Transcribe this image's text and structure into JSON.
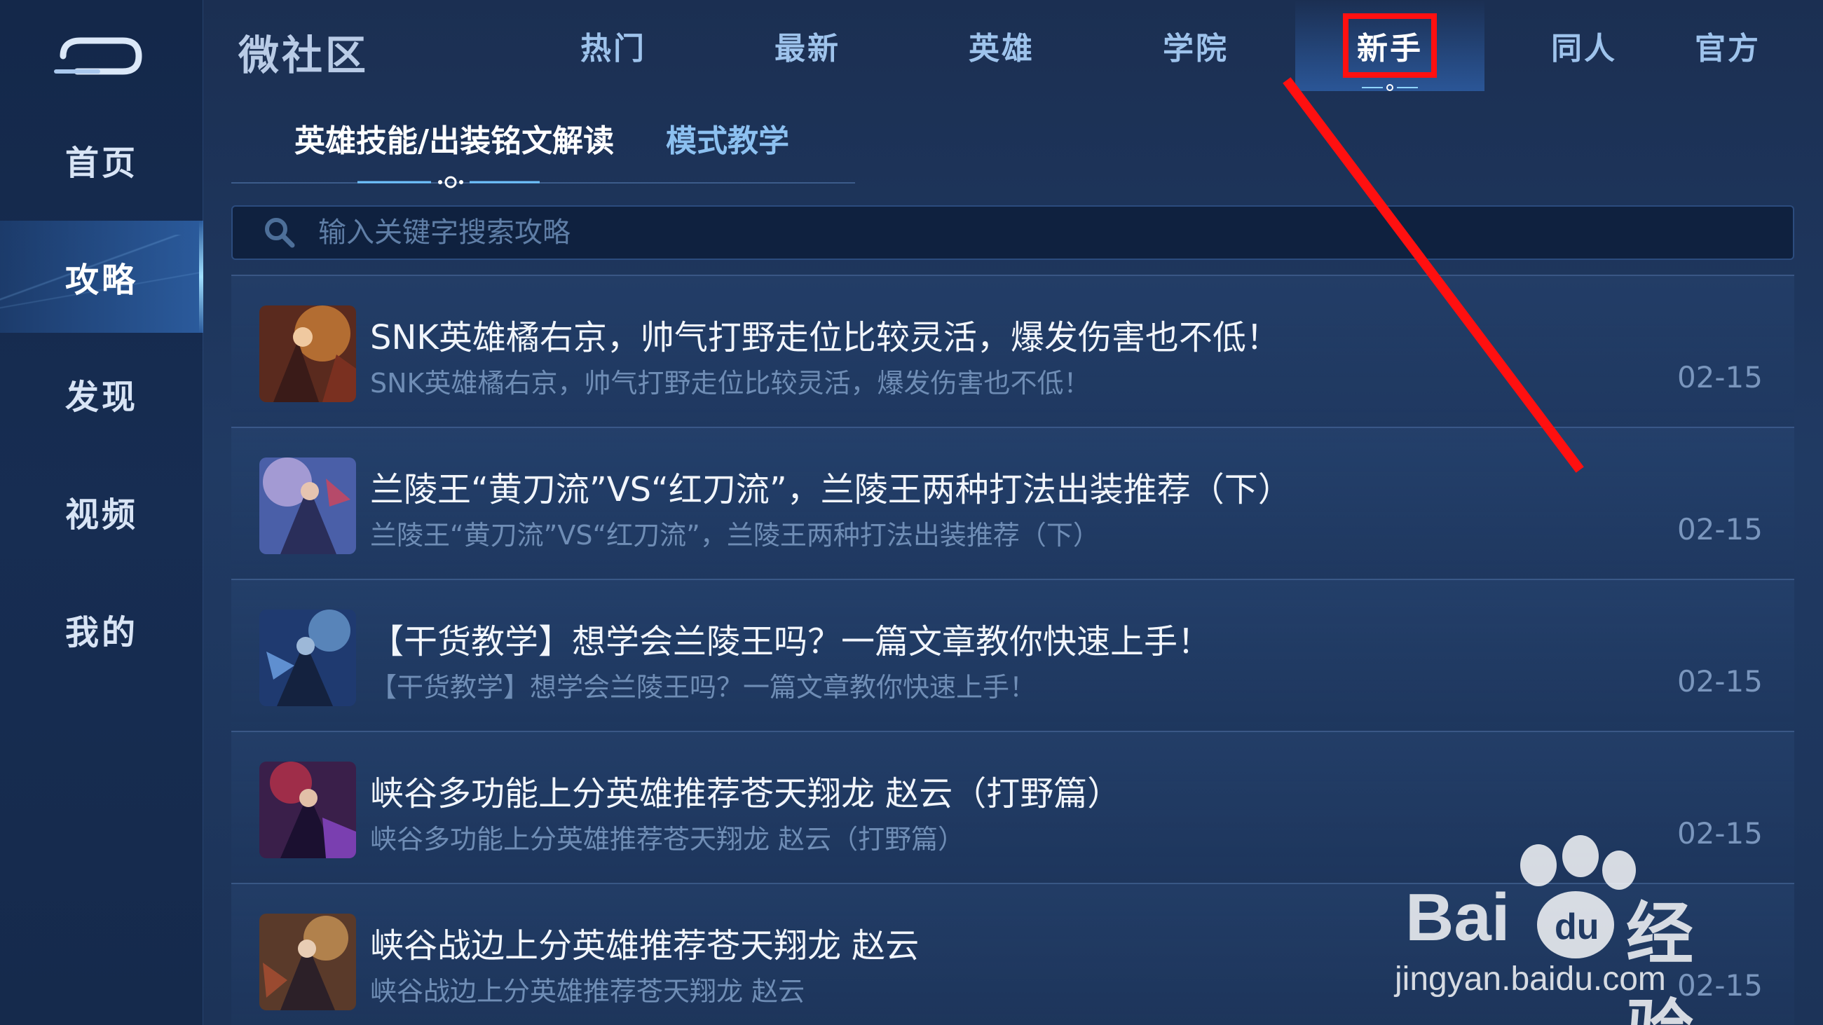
{
  "sidebar": {
    "back_icon": "back-arrow-icon",
    "items": [
      {
        "label": "首页"
      },
      {
        "label": "攻略",
        "active": true
      },
      {
        "label": "发现"
      },
      {
        "label": "视频"
      },
      {
        "label": "我的"
      }
    ]
  },
  "top_nav": {
    "brand": "微社区",
    "tabs": [
      {
        "label": "热门"
      },
      {
        "label": "最新"
      },
      {
        "label": "英雄"
      },
      {
        "label": "学院"
      },
      {
        "label": "新手",
        "active": true
      },
      {
        "label": "同人"
      },
      {
        "label": "官方"
      }
    ]
  },
  "sub_tabs": [
    {
      "label": "英雄技能/出装铭文解读",
      "active": true
    },
    {
      "label": "模式教学"
    }
  ],
  "search": {
    "placeholder": "输入关键字搜索攻略",
    "icon": "search-icon"
  },
  "articles": [
    {
      "title": "SNK英雄橘右京，帅气打野走位比较灵活，爆发伤害也不低！",
      "subtitle": "SNK英雄橘右京，帅气打野走位比较灵活，爆发伤害也不低！",
      "date": "02-15"
    },
    {
      "title": "兰陵王“黄刀流”VS“红刀流”，兰陵王两种打法出装推荐（下）",
      "subtitle": "兰陵王“黄刀流”VS“红刀流”，兰陵王两种打法出装推荐（下）",
      "date": "02-15"
    },
    {
      "title": "【干货教学】想学会兰陵王吗？一篇文章教你快速上手！",
      "subtitle": "【干货教学】想学会兰陵王吗？一篇文章教你快速上手！",
      "date": "02-15"
    },
    {
      "title": "峡谷多功能上分英雄推荐苍天翔龙 赵云（打野篇）",
      "subtitle": "峡谷多功能上分英雄推荐苍天翔龙 赵云（打野篇）",
      "date": "02-15"
    },
    {
      "title": "峡谷战边上分英雄推荐苍天翔龙 赵云",
      "subtitle": "峡谷战边上分英雄推荐苍天翔龙 赵云",
      "date": "02-15"
    }
  ],
  "watermark": {
    "brand": "Bai",
    "brand_cn": "经验",
    "url": "jingyan.baidu.com"
  },
  "colors": {
    "highlight": "#ff1010",
    "accent": "#9fe0ff",
    "background": "#1d3358"
  }
}
